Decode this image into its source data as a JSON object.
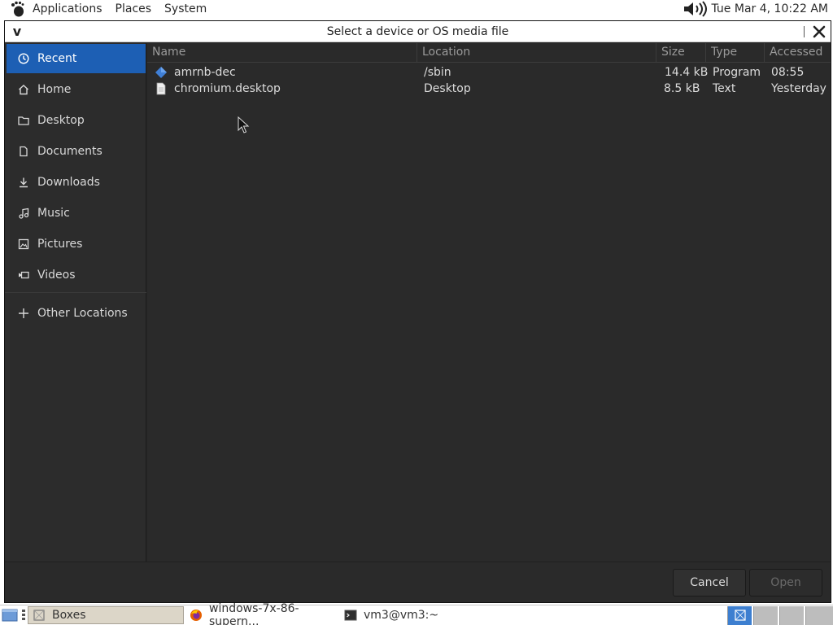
{
  "top_panel": {
    "menus": [
      "Applications",
      "Places",
      "System"
    ],
    "clock": "Tue Mar  4, 10:22 AM"
  },
  "dialog": {
    "title": "Select a device or OS media file",
    "sidebar": {
      "items": [
        {
          "label": "Recent",
          "icon": "clock-icon",
          "active": true
        },
        {
          "label": "Home",
          "icon": "home-icon"
        },
        {
          "label": "Desktop",
          "icon": "folder-icon"
        },
        {
          "label": "Documents",
          "icon": "document-icon"
        },
        {
          "label": "Downloads",
          "icon": "download-icon"
        },
        {
          "label": "Music",
          "icon": "music-icon"
        },
        {
          "label": "Pictures",
          "icon": "picture-icon"
        },
        {
          "label": "Videos",
          "icon": "video-icon"
        }
      ],
      "other_locations": {
        "label": "Other Locations",
        "icon": "plus-icon"
      }
    },
    "columns": {
      "name": "Name",
      "location": "Location",
      "size": "Size",
      "type": "Type",
      "accessed": "Accessed"
    },
    "files": [
      {
        "name": "amrnb-dec",
        "location": "/sbin",
        "size": "14.4 kB",
        "type": "Program",
        "accessed": "08:55",
        "icon": "executable-icon"
      },
      {
        "name": "chromium.desktop",
        "location": "Desktop",
        "size": "8.5 kB",
        "type": "Text",
        "accessed": "Yesterday",
        "icon": "text-file-icon"
      }
    ],
    "buttons": {
      "cancel": "Cancel",
      "open": "Open"
    }
  },
  "taskbar": {
    "tasks": [
      {
        "label": "Boxes",
        "active": true
      },
      {
        "label": "windows-7x-86-supern...",
        "active": false
      },
      {
        "label": "vm3@vm3:~",
        "active": false
      }
    ]
  },
  "colors": {
    "accent": "#1d5fb4",
    "dialog_bg": "#262626",
    "sidebar_bg": "#2c2c2c",
    "text": "#dcdcdc",
    "header_text": "#9a9a9a",
    "active_workspace": "#3d7fd0"
  }
}
